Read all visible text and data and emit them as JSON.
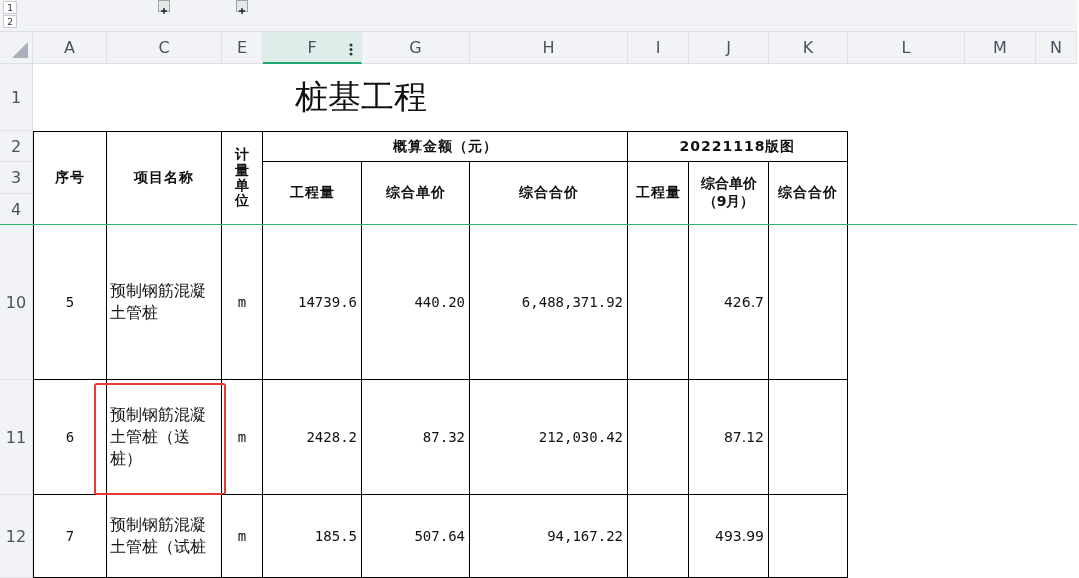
{
  "outline_levels": [
    "1",
    "2"
  ],
  "group_buttons": [
    {
      "expanded": false
    },
    {
      "expanded": false
    }
  ],
  "column_headers": [
    {
      "label": "A",
      "selected": false
    },
    {
      "label": "C",
      "selected": false
    },
    {
      "label": "E",
      "selected": false
    },
    {
      "label": "F",
      "selected": true
    },
    {
      "label": "G",
      "selected": false
    },
    {
      "label": "H",
      "selected": false
    },
    {
      "label": "I",
      "selected": false
    },
    {
      "label": "J",
      "selected": false
    },
    {
      "label": "K",
      "selected": false
    },
    {
      "label": "L",
      "selected": false
    },
    {
      "label": "M",
      "selected": false
    },
    {
      "label": "N",
      "selected": false
    }
  ],
  "row_headers": [
    "1",
    "2",
    "3",
    "4",
    "10",
    "11",
    "12"
  ],
  "title": "桩基工程",
  "table": {
    "header": {
      "seq": "序号",
      "name": "项目名称",
      "unit": "计量单位",
      "budget_group": "概算金额（元）",
      "budget_columns": [
        "工程量",
        "综合单价",
        "综合合价"
      ],
      "drawing_group": "20221118版图",
      "drawing_columns": [
        "工程量",
        "综合单价（9月）",
        "综合合价"
      ]
    },
    "rows": [
      {
        "seq": "5",
        "name": "预制钢筋混凝土管桩",
        "unit": "m",
        "quantity": "14739.6",
        "unit_price": "440.20",
        "total": "6,488,371.92",
        "drawing_unit_price": "426.7",
        "highlighted": false
      },
      {
        "seq": "6",
        "name": "预制钢筋混凝土管桩（送桩）",
        "unit": "m",
        "quantity": "2428.2",
        "unit_price": "87.32",
        "total": "212,030.42",
        "drawing_unit_price": "87.12",
        "highlighted": true
      },
      {
        "seq": "7",
        "name": "预制钢筋混凝土管桩（试桩",
        "unit": "m",
        "quantity": "185.5",
        "unit_price": "507.64",
        "total": "94,167.22",
        "drawing_unit_price": "493.99",
        "highlighted": false
      }
    ]
  }
}
